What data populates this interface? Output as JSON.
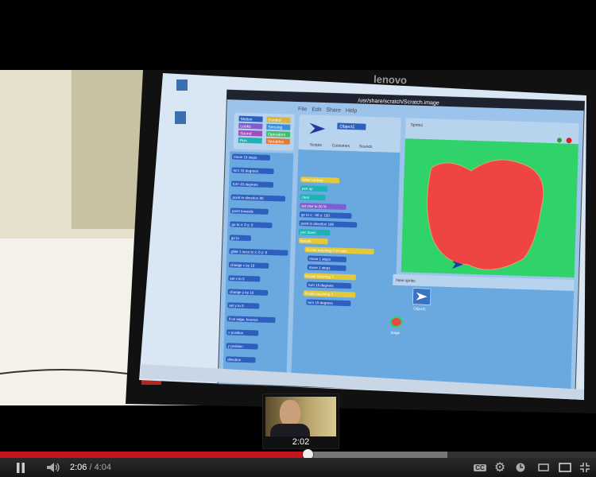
{
  "video": {
    "monitor_brand": "lenovo",
    "scratch": {
      "title_bar": "/usr/share/scratch/Scratch.image",
      "menu": [
        "File",
        "Edit",
        "Share",
        "Help"
      ],
      "categories": [
        "Motion",
        "Looks",
        "Sound",
        "Pen",
        "Control",
        "Sensing",
        "Operators",
        "Variables"
      ],
      "palette_blocks": [
        "move 10 steps",
        "turn 15 degrees",
        "turn 15 degrees",
        "point in direction 90",
        "point towards",
        "go to x: 0 y: 0",
        "go to",
        "glide 1 secs to x: 0 y: 0",
        "change x by 10",
        "set x to 0",
        "change y by 10",
        "set y to 0",
        "if on edge, bounce",
        "x position",
        "y position",
        "direction"
      ],
      "sprite_name": "Object1",
      "tabs": [
        "Scripts",
        "Costumes",
        "Sounds"
      ],
      "script_blocks": [
        "when clicked",
        "pen up",
        "clear",
        "set size to 20 %",
        "go to x: -40 y: 150",
        "point in direction 180",
        "pen down",
        "forever",
        "if color touching ? or color",
        "move 1 steps",
        "move 1 steps",
        "if color touching ?",
        "turn 15 degrees",
        "if color touching ?",
        "turn 15 degrees"
      ],
      "stage_label": "Sprite1",
      "new_sprite_label": "New sprite:",
      "sprite_list": [
        "Object1"
      ],
      "stage_thumb_label": "Stage"
    },
    "colors": {
      "stage_bg": "#2fd36a",
      "blob": "#ef4444",
      "scratch_bg": "#6aa8e0"
    }
  },
  "preview": {
    "time": "2:02"
  },
  "player": {
    "current_time": "2:06",
    "separator": "/",
    "duration": "4:04",
    "progress_percent": 51.6,
    "buffered_percent": 75,
    "accent": "#c4161c",
    "buttons": [
      "pause",
      "volume",
      "captions",
      "settings",
      "watch-later",
      "small-player",
      "large-player",
      "fullscreen"
    ],
    "cc_label": "CC"
  }
}
